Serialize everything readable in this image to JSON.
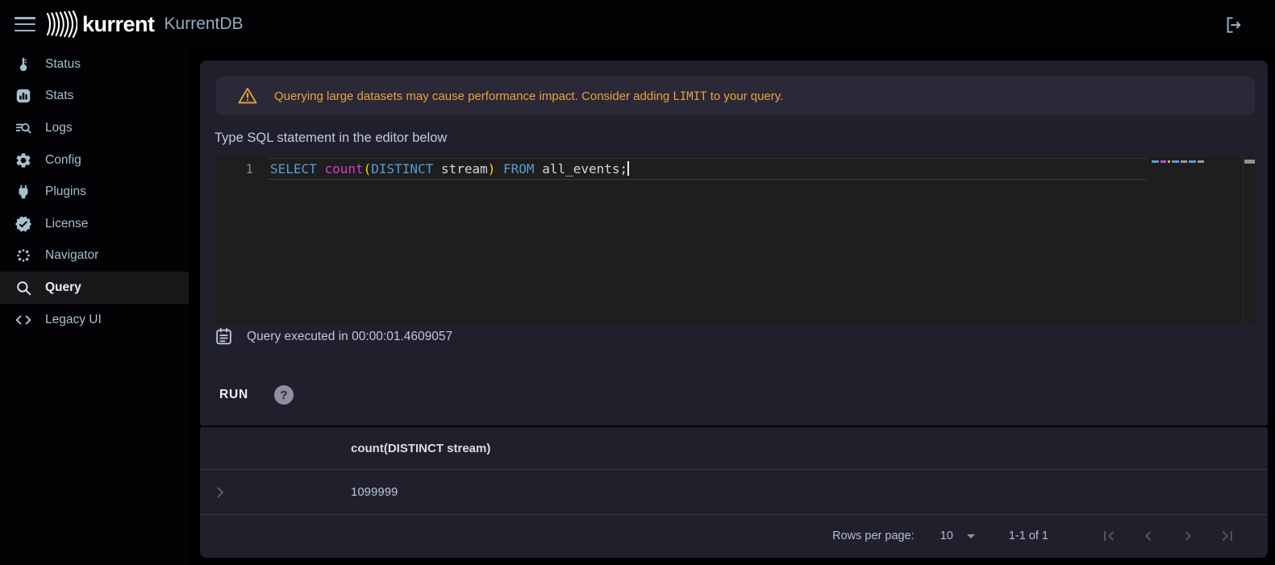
{
  "topbar": {
    "logo_text": "kurrent",
    "app_title": "KurrentDB"
  },
  "sidebar": {
    "items": [
      {
        "label": "Status",
        "icon": "thermometer-icon"
      },
      {
        "label": "Stats",
        "icon": "bar-chart-icon"
      },
      {
        "label": "Logs",
        "icon": "log-search-icon"
      },
      {
        "label": "Config",
        "icon": "gear-icon"
      },
      {
        "label": "Plugins",
        "icon": "plug-icon"
      },
      {
        "label": "License",
        "icon": "license-badge-icon"
      },
      {
        "label": "Navigator",
        "icon": "navigator-dots-icon"
      },
      {
        "label": "Query",
        "icon": "magnifier-icon",
        "active": true
      },
      {
        "label": "Legacy UI",
        "icon": "code-brackets-icon"
      }
    ]
  },
  "query": {
    "warning": {
      "text_before": "Querying large datasets may cause performance impact. Consider adding ",
      "code": "LIMIT",
      "text_after": " to your query."
    },
    "editor_hint": "Type SQL statement in the editor below",
    "editor": {
      "line_number": "1",
      "tokens": [
        {
          "text": "SELECT",
          "type": "keyword"
        },
        {
          "text": " ",
          "type": "plain"
        },
        {
          "text": "count",
          "type": "function"
        },
        {
          "text": "(",
          "type": "paren"
        },
        {
          "text": "DISTINCT",
          "type": "keyword"
        },
        {
          "text": " stream",
          "type": "plain"
        },
        {
          "text": ")",
          "type": "paren"
        },
        {
          "text": " ",
          "type": "plain"
        },
        {
          "text": "FROM",
          "type": "keyword"
        },
        {
          "text": " all_events;",
          "type": "plain"
        }
      ]
    },
    "status_text": "Query executed in 00:00:01.4609057",
    "run_label": "RUN",
    "help_glyph": "?"
  },
  "results": {
    "columns": [
      "count(DISTINCT stream)"
    ],
    "rows": [
      [
        "1099999"
      ]
    ],
    "pagination": {
      "rows_per_page_label": "Rows per page:",
      "page_size": "10",
      "range_label": "1-1 of 1"
    }
  },
  "colors": {
    "warning_accent": "#e9a43e",
    "keyword": "#569cd6",
    "function_name": "#d63bc8",
    "paren": "#ffd700",
    "sidebar_text": "#a7bfce",
    "card_bg": "#221f2c",
    "editor_bg": "#1e1e1e"
  }
}
